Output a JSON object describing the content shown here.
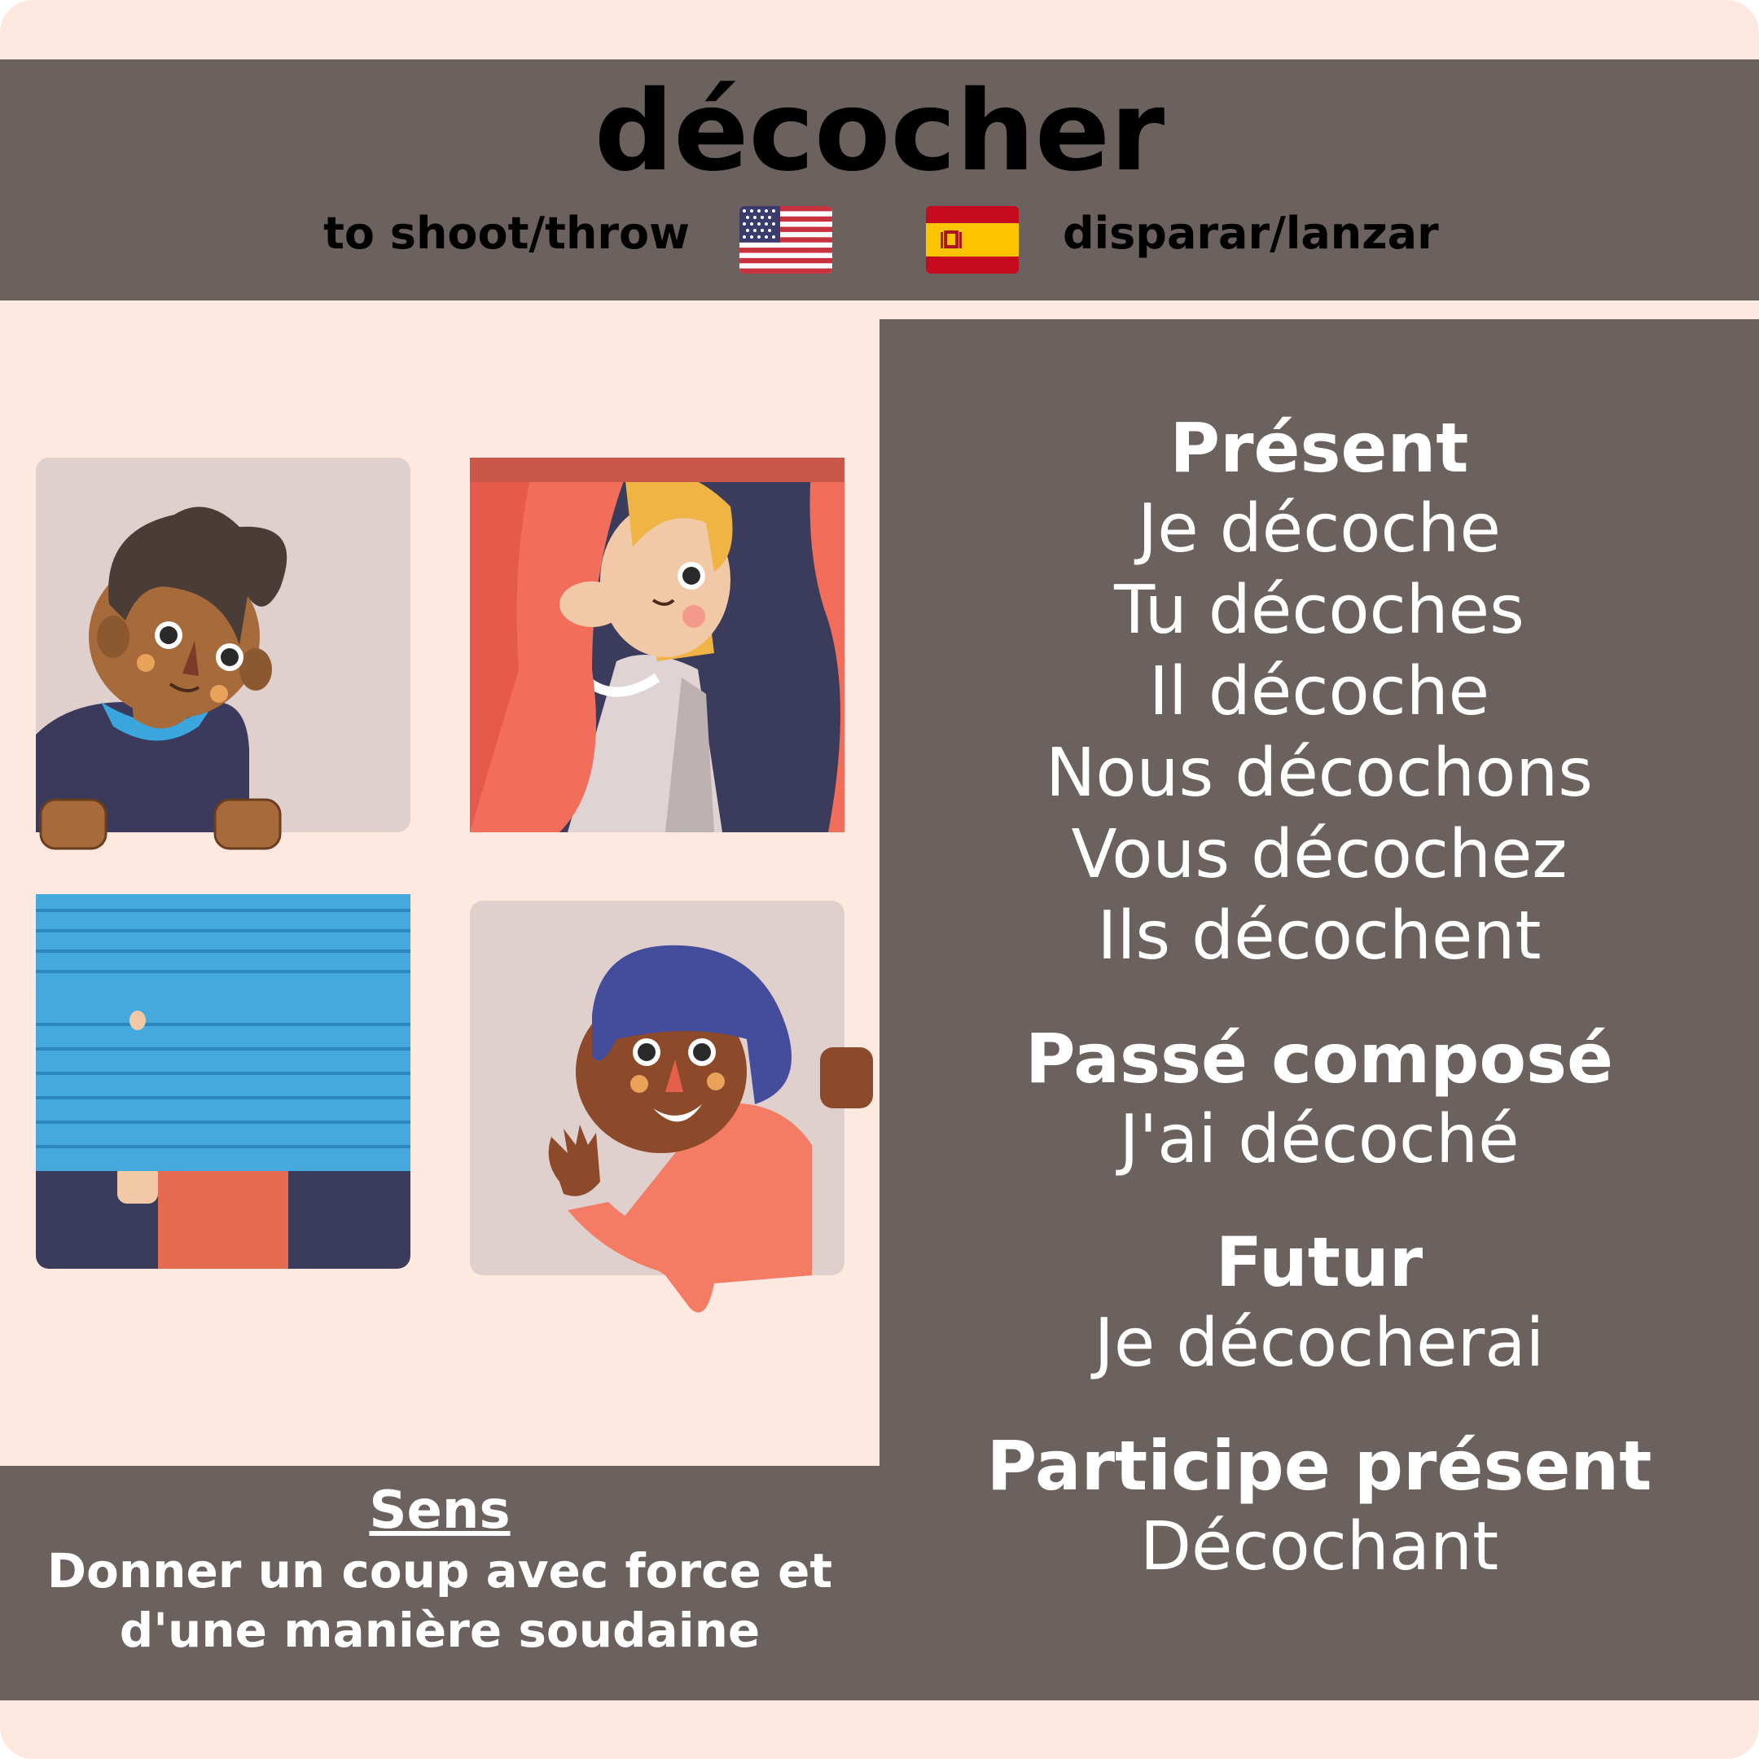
{
  "verb": "décocher",
  "translations": {
    "english": "to shoot/throw",
    "spanish": "disparar/lanzar",
    "english_flag_icon": "us-flag-icon",
    "spanish_flag_icon": "spain-flag-icon"
  },
  "sens": {
    "title": "Sens",
    "line1": "Donner un coup avec force et",
    "line2": "d'une manière soudaine"
  },
  "conjugations": {
    "present": {
      "label": "Présent",
      "forms": [
        "Je décoche",
        "Tu décoches",
        "Il décoche",
        "Nous décochons",
        "Vous décochez",
        "Ils décochent"
      ]
    },
    "passe_compose": {
      "label": "Passé composé",
      "form": "J'ai décoché"
    },
    "futur": {
      "label": "Futur",
      "form": "Je décocherai"
    },
    "participe_present": {
      "label": "Participe présent",
      "form": "Décochant"
    }
  },
  "colors": {
    "background": "#fee9e1",
    "panel": "#6b625f",
    "text": "#ffffff"
  },
  "illustrations": [
    "boy-peeking-illustration",
    "woman-behind-curtain-illustration",
    "person-behind-blinds-illustration",
    "woman-waving-illustration"
  ]
}
